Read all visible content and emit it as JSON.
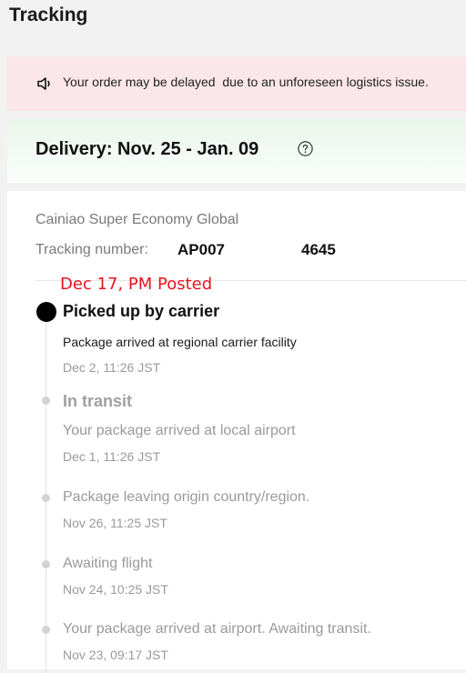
{
  "page": {
    "title": "Tracking"
  },
  "alert": {
    "icon": "speaker-icon",
    "message": "Your order may be delayed  due to an unforeseen logistics issue."
  },
  "delivery": {
    "text": "Delivery: Nov. 25 - Jan. 09",
    "help_icon": "question-circle-icon"
  },
  "tracking": {
    "carrier": "Cainiao Super Economy Global",
    "number_label": "Tracking number:",
    "number_start": "AP007",
    "number_end": "4645",
    "annotation": "Dec 17, PM Posted",
    "events": [
      {
        "title": "Picked up by carrier",
        "description": "Package arrived at regional carrier facility",
        "time": "Dec 2, 11:26 JST"
      },
      {
        "title": "In transit",
        "description": "Your package arrived at local airport",
        "time": "Dec 1, 11:26 JST"
      },
      {
        "title": "",
        "description": "Package leaving origin country/region.",
        "time": "Nov 26, 11:25 JST"
      },
      {
        "title": "",
        "description": "Awaiting flight",
        "time": "Nov 24, 10:25 JST"
      },
      {
        "title": "",
        "description": "Your package arrived at airport. Awaiting transit.",
        "time": "Nov 23, 09:17 JST"
      }
    ]
  },
  "colors": {
    "alert_bg": "#fbe7e9",
    "delivery_bg": "#e9f6eb",
    "annotation": "#e8141e"
  }
}
